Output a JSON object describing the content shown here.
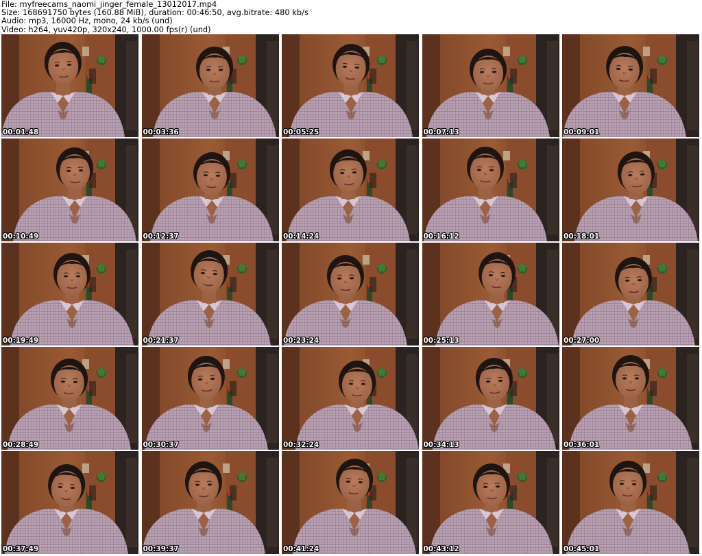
{
  "header": {
    "file_line": "File: myfreecams_naomi_jinger_female_13012017.mp4",
    "size_line": "Size: 168691750 bytes (160.88 MiB), duration: 00:46:50, avg.bitrate: 480 kb/s",
    "audio_line": "Audio: mp3, 16000 Hz, mono, 24 kb/s (und)",
    "video_line": "Video: h264, yuv420p, 320x240, 1000.00 fps(r) (und)"
  },
  "colors": {
    "background": "#ffffff",
    "text": "#000000",
    "timestamp_text": "#ffffff",
    "timestamp_outline": "#000000",
    "wall_wood": "#9a5a34",
    "door_dark": "#2b2320",
    "shirt": "#b9a3b3",
    "skin": "#9b6246",
    "hair": "#1e1512"
  },
  "thumbnails": [
    {
      "timestamp": "00:01:48"
    },
    {
      "timestamp": "00:03:36"
    },
    {
      "timestamp": "00:05:25"
    },
    {
      "timestamp": "00:07:13"
    },
    {
      "timestamp": "00:09:01"
    },
    {
      "timestamp": "00:10:49"
    },
    {
      "timestamp": "00:12:37"
    },
    {
      "timestamp": "00:14:24"
    },
    {
      "timestamp": "00:16:12"
    },
    {
      "timestamp": "00:18:01"
    },
    {
      "timestamp": "00:19:49"
    },
    {
      "timestamp": "00:21:37"
    },
    {
      "timestamp": "00:23:24"
    },
    {
      "timestamp": "00:25:13"
    },
    {
      "timestamp": "00:27:00"
    },
    {
      "timestamp": "00:28:49"
    },
    {
      "timestamp": "00:30:37"
    },
    {
      "timestamp": "00:32:24"
    },
    {
      "timestamp": "00:34:13"
    },
    {
      "timestamp": "00:36:01"
    },
    {
      "timestamp": "00:37:49"
    },
    {
      "timestamp": "00:39:37"
    },
    {
      "timestamp": "00:41:24"
    },
    {
      "timestamp": "00:43:12"
    },
    {
      "timestamp": "00:45:01"
    }
  ]
}
